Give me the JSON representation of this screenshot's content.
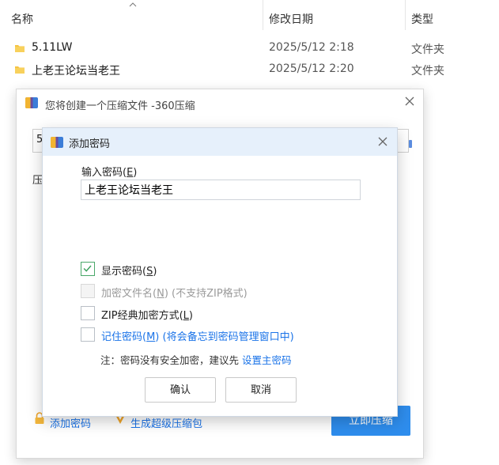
{
  "explorer": {
    "columns": {
      "name": "名称",
      "modified": "修改日期",
      "type": "类型"
    },
    "files": [
      {
        "name": "5.11LW",
        "modified": "2025/5/12 2:18",
        "type": "文件夹"
      },
      {
        "name": "上老王论坛当老王",
        "modified": "2025/5/12 2:20",
        "type": "文件夹"
      }
    ]
  },
  "compress_dialog": {
    "title": "您将创建一个压缩文件 -360压缩",
    "path_partial": "5",
    "label_partial": "压",
    "add_password_link": "添加密码",
    "make_super_archive_link": "生成超级压缩包",
    "compress_now_button": "立即压缩"
  },
  "password_dialog": {
    "title": "添加密码",
    "password_label": "输入密码(",
    "password_label_key": "E",
    "password_label_end": ")",
    "password_value": "上老王论坛当老王",
    "options": {
      "show_password": {
        "text": "显示密码(",
        "key": "S",
        "end": ")",
        "checked": true
      },
      "encrypt_filenames": {
        "text": "加密文件名(",
        "key": "N",
        "end": ") (不支持ZIP格式)",
        "checked": false
      },
      "zip_classic": {
        "text": "ZIP经典加密方式(",
        "key": "L",
        "end": ")",
        "checked": false
      },
      "remember_password": {
        "text": "记住密码(",
        "key": "M",
        "end": ") (将会备忘到密码管理窗口中)",
        "checked": false
      }
    },
    "note_prefix": "注：密码没有安全加密，建议先 ",
    "note_link": "设置主密码",
    "ok_button": "确认",
    "cancel_button": "取消"
  },
  "colors": {
    "accent": "#2e8ded",
    "link": "#1a73e8",
    "title_bar": "#e6f0fb",
    "check": "#4aa86a",
    "folder": "#f5c342"
  }
}
